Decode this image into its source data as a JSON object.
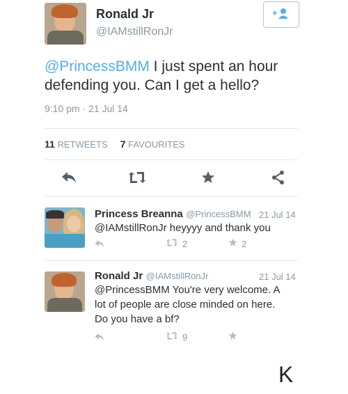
{
  "main_tweet": {
    "name": "Ronald Jr",
    "handle": "@IAMstillRonJr",
    "mention": "@PrincessBMM",
    "text_rest": " I just spent an hour defending you. Can I get a hello?",
    "timestamp": "9:10 pm · 21 Jul 14",
    "retweets_count": "11",
    "retweets_label": "RETWEETS",
    "favourites_count": "7",
    "favourites_label": "FAVOURITES",
    "follow_icon": "follow-plus-person-icon"
  },
  "replies": [
    {
      "name": "Princess Breanna",
      "handle": "@PrincessBMM",
      "time": "21 Jul 14",
      "text": "@IAMstillRonJr heyyyy and thank you",
      "retweets": "2",
      "favourites": "2"
    },
    {
      "name": "Ronald Jr",
      "handle": "@IAMstillRonJr",
      "time": "21 Jul 14",
      "text_line1": "@PrincessBMM You're very welcome. A",
      "text_line2": "lot of people are close minded on here.",
      "text_line3": "Do you have a bf?",
      "retweets": "9"
    }
  ],
  "caption": "K",
  "colors": {
    "accent": "#55acee",
    "muted": "#8899a6",
    "text": "#292f33"
  }
}
